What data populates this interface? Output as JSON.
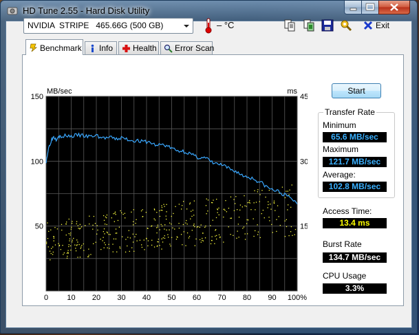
{
  "window": {
    "title": "HD Tune 2.55 - Hard Disk Utility"
  },
  "toolbar": {
    "drive": "NVIDIA  STRIPE   465.66G (500 GB)",
    "temperature": "– °C",
    "exit_label": "Exit",
    "icons": [
      "copy-text-icon",
      "copy-screenshot-icon",
      "save-icon",
      "options-icon"
    ]
  },
  "tabs": [
    {
      "label": "Benchmark",
      "icon": "benchmark-icon",
      "active": true
    },
    {
      "label": "Info",
      "icon": "info-icon",
      "active": false
    },
    {
      "label": "Health",
      "icon": "health-icon",
      "active": false
    },
    {
      "label": "Error Scan",
      "icon": "error-scan-icon",
      "active": false
    }
  ],
  "benchmark": {
    "start_label": "Start",
    "transfer_rate_title": "Transfer Rate",
    "minimum_label": "Minimum",
    "minimum_value": "65.6 MB/sec",
    "maximum_label": "Maximum",
    "maximum_value": "121.7 MB/sec",
    "average_label": "Average:",
    "average_value": "102.8 MB/sec",
    "access_time_label": "Access Time:",
    "access_time_value": "13.4 ms",
    "burst_rate_label": "Burst Rate",
    "burst_rate_value": "134.7 MB/sec",
    "cpu_usage_label": "CPU Usage",
    "cpu_usage_value": "3.3%"
  },
  "chart_data": {
    "type": "line",
    "ylabel_left": "MB/sec",
    "ylabel_right": "ms",
    "xlim": [
      0,
      100
    ],
    "ylim_left": [
      0,
      150
    ],
    "ylim_right": [
      0,
      45
    ],
    "x_ticks": [
      "0",
      "10",
      "20",
      "30",
      "40",
      "50",
      "60",
      "70",
      "80",
      "90",
      "100%"
    ],
    "y_left_ticks": [
      "50",
      "100",
      "150"
    ],
    "y_right_ticks": [
      "15",
      "30",
      "45"
    ],
    "grid": true,
    "background": "#000000",
    "series": [
      {
        "color": "#3aa8ff",
        "x": [
          0,
          1,
          2,
          3,
          4,
          5,
          6,
          8,
          10,
          12,
          14,
          16,
          18,
          20,
          22,
          24,
          26,
          28,
          30,
          32,
          34,
          36,
          38,
          40,
          42,
          44,
          46,
          48,
          50,
          52,
          54,
          56,
          58,
          60,
          62,
          64,
          66,
          68,
          70,
          72,
          74,
          76,
          78,
          80,
          82,
          84,
          86,
          88,
          90,
          92,
          94,
          96,
          98,
          100
        ],
        "y": [
          100,
          110,
          116,
          119,
          117,
          120,
          118,
          120,
          119,
          120,
          120,
          119,
          119,
          120,
          118,
          118,
          118,
          117,
          118,
          117,
          116,
          116,
          115,
          115,
          114,
          112,
          113,
          112,
          110,
          108,
          108,
          107,
          105,
          103,
          103,
          102,
          99,
          98,
          97,
          95,
          93,
          92,
          89,
          88,
          87,
          85,
          83,
          80,
          78,
          77,
          75,
          73,
          71,
          67
        ]
      },
      {
        "color": "#ffff40",
        "kind": "scatter",
        "x_range": [
          0,
          100
        ],
        "y_low_start": 7,
        "y_high_start": 16,
        "y_low_end": 13,
        "y_high_end": 25
      }
    ]
  }
}
